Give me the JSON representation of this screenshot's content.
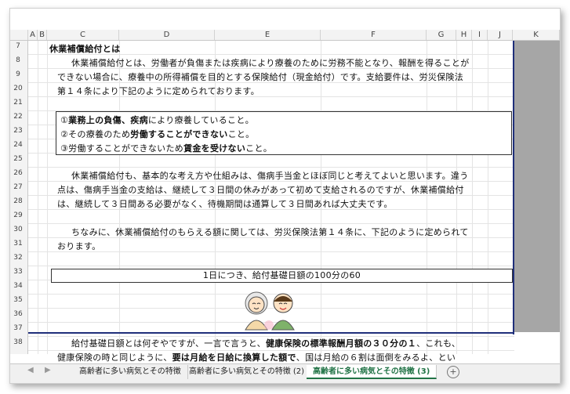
{
  "columns": [
    "A",
    "B",
    "C",
    "D",
    "E",
    "F",
    "G",
    "H",
    "I",
    "J",
    "K"
  ],
  "rows": [
    "7",
    "8",
    "9",
    "20",
    "21",
    "22",
    "23",
    "24",
    "25",
    "26",
    "27",
    "28",
    "29",
    "30",
    "31",
    "32",
    "33",
    "34",
    "35",
    "36",
    "37",
    "38"
  ],
  "heading": "休業補償給付とは",
  "para1": [
    "休業補償給付とは、労働者が負傷または疾病により療養のために労務不能となり、報酬を得ることが",
    "できない場合に、療養中の所得補償を目的とする保険給付（現金給付）です。支給要件は、労災保険法",
    "第１４条により下記のように定められております。"
  ],
  "conditions": [
    {
      "pre": "①",
      "bold": "業務上の負傷、疾病",
      "post": "により療養していること。"
    },
    {
      "pre": "②その療養のため",
      "bold": "労働することができない",
      "post": "こと。"
    },
    {
      "pre": "③労働することができないため",
      "bold": "賃金を受けない",
      "post": "こと。"
    }
  ],
  "para2": [
    "休業補償給付も、基本的な考え方や仕組みは、傷病手当金とほぼ同じと考えてよいと思います。違う",
    "点は、傷病手当金の支給は、継続して３日間の休みがあって初めて支給されるのですが、休業補償給付",
    "は、継続して３日間ある必要がなく、待機期間は通算して３日間あれば大丈夫です。"
  ],
  "para3": [
    "ちなみに、休業補償給付のもらえる額に関しては、労災保険法第１４条に、下記のように定められて",
    "おります。"
  ],
  "formula": "1日につき、給付基礎日額の100分の60",
  "para4": {
    "l1_pre": "給付基礎日額とは何ぞやですが、一言で言うと、",
    "l1_bold": "健康保険の標準報酬月額の３０分の１",
    "l1_post": "、これも、",
    "l2_pre": "健康保険の時と同じように、",
    "l2_bold": "要は月給を日給に換算した額で",
    "l2_post": "、国は月給の６割は面倒をみるよ、とい"
  },
  "tabs": [
    "高齢者に多い病気とその特徴",
    "高齢者に多い病気とその特徴 (2)",
    "高齢者に多い病気とその特徴 (3)"
  ],
  "nav": {
    "prev": "◀",
    "next": "▶"
  },
  "add_tab": "+"
}
